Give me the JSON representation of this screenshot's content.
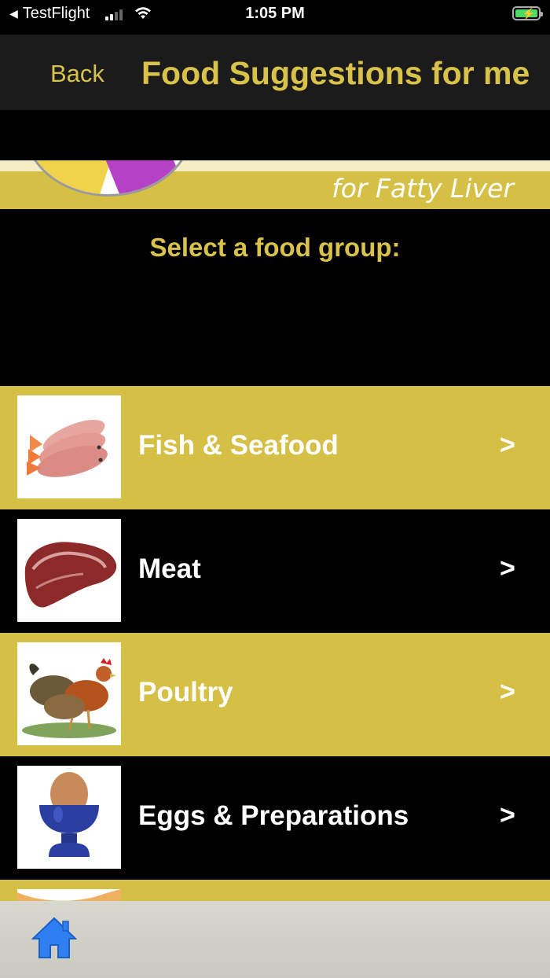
{
  "status_bar": {
    "back_app": "TestFlight",
    "time": "1:05 PM"
  },
  "nav": {
    "back_label": "Back",
    "title": "Food Suggestions for me"
  },
  "banner": {
    "subtitle": "for Fatty Liver"
  },
  "prompt": "Select a food group:",
  "food_groups": [
    {
      "label": "Fish & Seafood",
      "chevron": ">",
      "image": "fish-image"
    },
    {
      "label": "Meat",
      "chevron": ">",
      "image": "steak-image"
    },
    {
      "label": "Poultry",
      "chevron": ">",
      "image": "chickens-image"
    },
    {
      "label": "Eggs & Preparations",
      "chevron": ">",
      "image": "egg-cup-image"
    }
  ],
  "tab_bar": {
    "icon": "home-icon"
  },
  "colors": {
    "accent": "#d9c24a",
    "row_gold": "#d6bf45",
    "nav_bg": "#1b1b1b",
    "home_blue": "#2f7ff0"
  }
}
